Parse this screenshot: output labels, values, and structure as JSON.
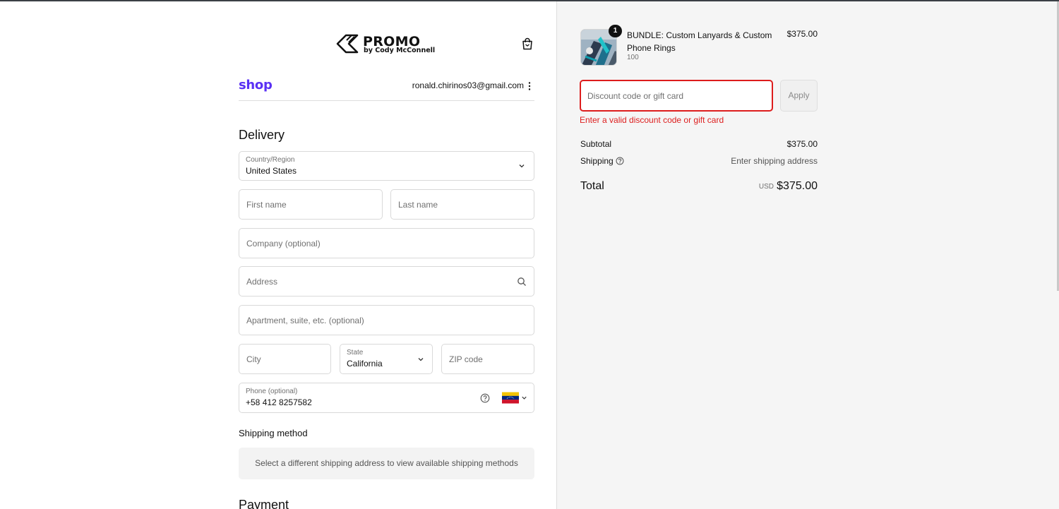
{
  "brand": {
    "logo_name": "PROMO",
    "logo_sub": "by Cody McConnell"
  },
  "account": {
    "shop_label": "shop",
    "email": "ronald.chirinos03@gmail.com"
  },
  "delivery": {
    "heading": "Delivery",
    "country_label": "Country/Region",
    "country_value": "United States",
    "first_name_placeholder": "First name",
    "last_name_placeholder": "Last name",
    "company_placeholder": "Company (optional)",
    "address_placeholder": "Address",
    "apartment_placeholder": "Apartment, suite, etc. (optional)",
    "city_placeholder": "City",
    "state_label": "State",
    "state_value": "California",
    "zip_placeholder": "ZIP code",
    "phone_label": "Phone (optional)",
    "phone_value": "+58 412 8257582"
  },
  "shipping_method": {
    "heading": "Shipping method",
    "notice": "Select a different shipping address to view available shipping methods"
  },
  "payment": {
    "heading": "Payment"
  },
  "order": {
    "item": {
      "quantity": "1",
      "title": "BUNDLE: Custom Lanyards & Custom Phone Rings",
      "variant": "100",
      "price": "$375.00"
    },
    "discount_placeholder": "Discount code or gift card",
    "apply_label": "Apply",
    "discount_error": "Enter a valid discount code or gift card",
    "subtotal_label": "Subtotal",
    "subtotal_value": "$375.00",
    "shipping_label": "Shipping",
    "shipping_value": "Enter shipping address",
    "total_label": "Total",
    "total_currency": "USD",
    "total_value": "$375.00"
  },
  "colors": {
    "shop_brand": "#5a31f4",
    "error": "#dd1d1d",
    "summary_bg": "#f5f5f5"
  }
}
